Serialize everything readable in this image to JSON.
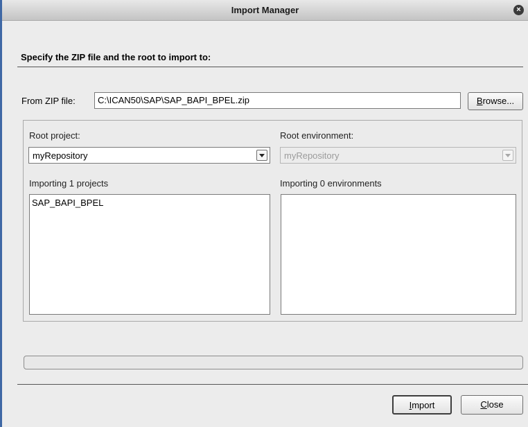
{
  "window": {
    "title": "Import Manager",
    "close_glyph": "×"
  },
  "heading": "Specify the ZIP file and the root to import to:",
  "zip": {
    "label": "From ZIP file:",
    "value": "C:\\ICAN50\\SAP\\SAP_BAPI_BPEL.zip",
    "browse_mnemonic": "B",
    "browse_rest": "rowse..."
  },
  "root_project": {
    "label": "Root project:",
    "selected": "myRepository",
    "list_label": "Importing 1 projects",
    "items": [
      "SAP_BAPI_BPEL"
    ]
  },
  "root_environment": {
    "label": "Root environment:",
    "selected": "myRepository",
    "disabled": true,
    "list_label": "Importing 0 environments",
    "items": []
  },
  "progress": {
    "value": 0
  },
  "buttons": {
    "import_mnemonic": "I",
    "import_rest": "mport",
    "close_mnemonic": "C",
    "close_rest": "lose"
  },
  "colors": {
    "window_bg": "#ececec",
    "left_border": "#3f68a5",
    "close_icon_bg": "#3a3a3a"
  }
}
